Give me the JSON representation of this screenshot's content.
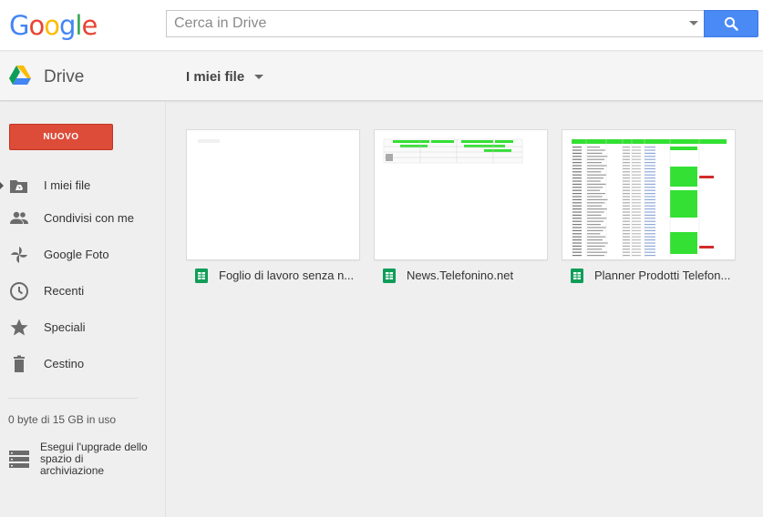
{
  "brand": {
    "logo_letters": [
      "G",
      "o",
      "o",
      "g",
      "l",
      "e"
    ],
    "logo_colors": [
      "#4285f4",
      "#ea4335",
      "#fbbc05",
      "#4285f4",
      "#34a853",
      "#ea4335"
    ],
    "app_name": "Drive"
  },
  "search": {
    "placeholder": "Cerca in Drive",
    "value": "",
    "button_icon": "search-icon",
    "button_color": "#4a8af4"
  },
  "header": {
    "current_folder": "I miei file"
  },
  "sidebar": {
    "new_button_label": "NUOVO",
    "new_button_color": "#dd4b39",
    "items": [
      {
        "label": "I miei file",
        "icon": "my-drive-folder-icon",
        "active": true
      },
      {
        "label": "Condivisi con me",
        "icon": "people-icon",
        "active": false
      },
      {
        "label": "Google Foto",
        "icon": "pinwheel-icon",
        "active": false
      },
      {
        "label": "Recenti",
        "icon": "clock-icon",
        "active": false
      },
      {
        "label": "Speciali",
        "icon": "star-icon",
        "active": false
      },
      {
        "label": "Cestino",
        "icon": "trash-icon",
        "active": false
      }
    ],
    "quota_text": "0 byte di 15 GB in uso",
    "upgrade_text": "Esegui l'upgrade dello spazio di archiviazione",
    "upgrade_icon": "storage-icon"
  },
  "files": [
    {
      "name": "Foglio di lavoro senza n...",
      "type_icon": "sheets-icon",
      "thumbnail": "blank"
    },
    {
      "name": "News.Telefonino.net",
      "type_icon": "sheets-icon",
      "thumbnail": "small-table"
    },
    {
      "name": "Planner Prodotti Telefon...",
      "type_icon": "sheets-icon",
      "thumbnail": "dense-table-green"
    }
  ],
  "colors": {
    "sheets_green": "#0f9d58",
    "highlight_green": "#33e033",
    "highlight_red": "#d22b2b"
  }
}
